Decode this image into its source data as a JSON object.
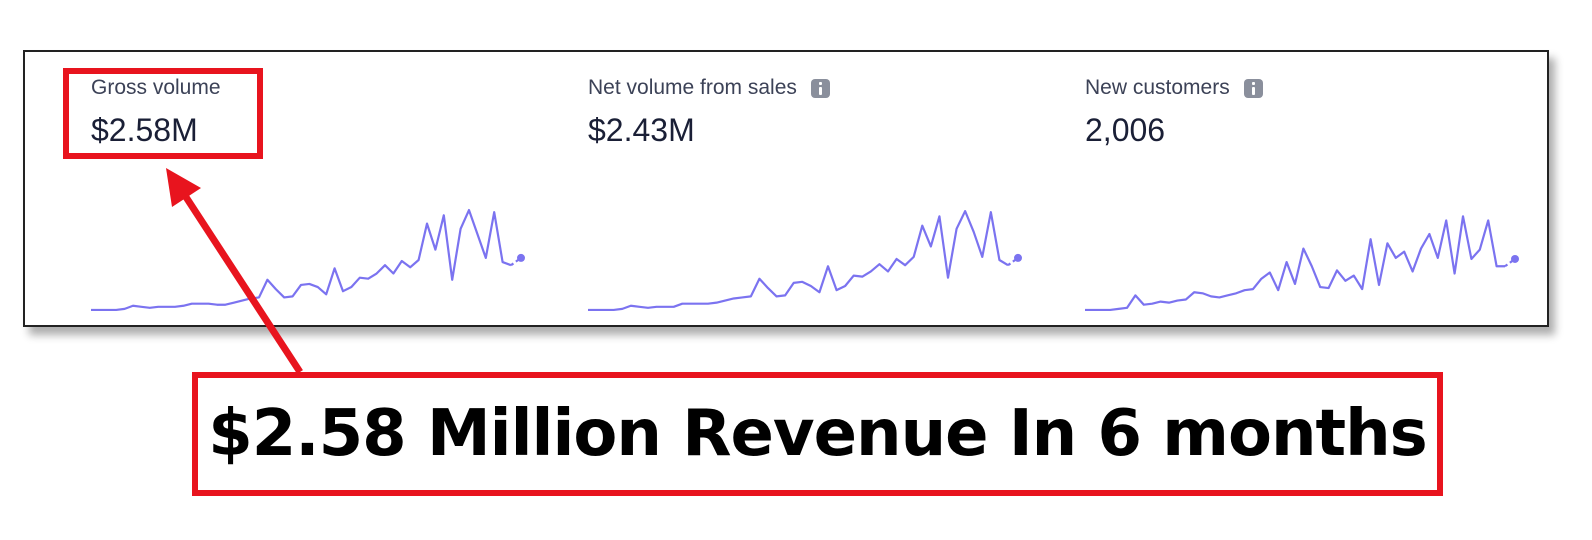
{
  "colors": {
    "sparkline": "#7b73f0",
    "annotation": "#e8141e"
  },
  "metrics": [
    {
      "label": "Gross volume",
      "value": "$2.58M",
      "has_info_icon": false,
      "icon": "",
      "trend": [
        0.02,
        0.02,
        0.02,
        0.02,
        0.03,
        0.06,
        0.05,
        0.04,
        0.05,
        0.05,
        0.05,
        0.06,
        0.08,
        0.08,
        0.08,
        0.07,
        0.07,
        0.09,
        0.11,
        0.13,
        0.14,
        0.31,
        0.22,
        0.14,
        0.15,
        0.26,
        0.27,
        0.24,
        0.17,
        0.42,
        0.2,
        0.24,
        0.33,
        0.32,
        0.37,
        0.45,
        0.37,
        0.49,
        0.43,
        0.5,
        0.85,
        0.6,
        0.93,
        0.31,
        0.8,
        0.98,
        0.75,
        0.52,
        0.96,
        0.48,
        0.45,
        0.52
      ]
    },
    {
      "label": "Net volume from sales",
      "value": "$2.43M",
      "has_info_icon": true,
      "icon": "info-icon",
      "trend": [
        0.02,
        0.02,
        0.02,
        0.02,
        0.03,
        0.06,
        0.05,
        0.04,
        0.05,
        0.05,
        0.05,
        0.08,
        0.08,
        0.08,
        0.08,
        0.09,
        0.11,
        0.13,
        0.14,
        0.15,
        0.32,
        0.23,
        0.15,
        0.16,
        0.28,
        0.29,
        0.25,
        0.19,
        0.44,
        0.21,
        0.25,
        0.35,
        0.34,
        0.39,
        0.46,
        0.39,
        0.51,
        0.45,
        0.53,
        0.83,
        0.63,
        0.92,
        0.33,
        0.8,
        0.97,
        0.77,
        0.53,
        0.96,
        0.5,
        0.45,
        0.52
      ]
    },
    {
      "label": "New customers",
      "value": "2,006",
      "has_info_icon": true,
      "icon": "info-icon",
      "trend": [
        0.02,
        0.02,
        0.02,
        0.02,
        0.03,
        0.04,
        0.16,
        0.07,
        0.08,
        0.1,
        0.09,
        0.11,
        0.12,
        0.19,
        0.18,
        0.15,
        0.14,
        0.16,
        0.18,
        0.21,
        0.22,
        0.32,
        0.38,
        0.21,
        0.48,
        0.27,
        0.61,
        0.44,
        0.24,
        0.23,
        0.4,
        0.3,
        0.35,
        0.22,
        0.7,
        0.26,
        0.66,
        0.52,
        0.58,
        0.39,
        0.61,
        0.75,
        0.52,
        0.88,
        0.37,
        0.92,
        0.51,
        0.6,
        0.88,
        0.44,
        0.44,
        0.51
      ]
    }
  ],
  "annotation": {
    "caption": "$2.58 Million Revenue In 6 months"
  }
}
